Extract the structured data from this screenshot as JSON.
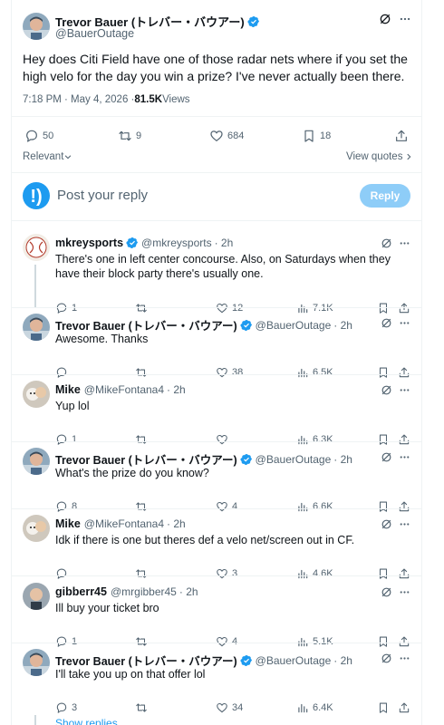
{
  "main_tweet": {
    "author_name": "Trevor Bauer (トレバー・バウアー)",
    "author_handle": "@BauerOutage",
    "text": "Hey does Citi Field have one of those radar nets where if you set the high velo for the day you win a prize? I've never actually been there.",
    "time": "7:18 PM · May 4, 2026 · ",
    "views_count": "81.5K",
    "views_label": " Views",
    "replies": "50",
    "reposts": "9",
    "likes": "684",
    "bookmarks": "18"
  },
  "sort": {
    "label": "Relevant",
    "view_quotes": "View quotes"
  },
  "reply_box": {
    "placeholder": "Post your reply",
    "button": "Reply"
  },
  "replies": [
    {
      "name": "mkreysports",
      "handle": "@mkreysports",
      "time": "· 2h",
      "verified": true,
      "text": "There's one in left center concourse.  Also, on Saturdays when they have their block party there's usually one.",
      "reply_count": "1",
      "repost_count": "",
      "like_count": "12",
      "view_count": "7.1K"
    },
    {
      "name": "Trevor Bauer (トレバー・バウアー)",
      "handle": "@BauerOutage",
      "time": "· 2h",
      "verified": true,
      "text": "Awesome. Thanks",
      "reply_count": "",
      "repost_count": "",
      "like_count": "38",
      "view_count": "6.5K"
    },
    {
      "name": "Mike",
      "handle": "@MikeFontana4",
      "time": "· 2h",
      "verified": false,
      "text": "Yup lol",
      "reply_count": "1",
      "repost_count": "",
      "like_count": "",
      "view_count": "6.3K"
    },
    {
      "name": "Trevor Bauer (トレバー・バウアー)",
      "handle": "@BauerOutage",
      "time": "· 2h",
      "verified": true,
      "text": "What's the prize do you know?",
      "reply_count": "8",
      "repost_count": "",
      "like_count": "4",
      "view_count": "6.6K"
    },
    {
      "name": "Mike",
      "handle": "@MikeFontana4",
      "time": "· 2h",
      "verified": false,
      "text": "Idk if there is one but theres def a velo net/screen out in CF.",
      "reply_count": "",
      "repost_count": "",
      "like_count": "3",
      "view_count": "4.6K"
    },
    {
      "name": "gibberr45",
      "handle": "@mrgibber45",
      "time": "· 2h",
      "verified": false,
      "text": "Ill buy your ticket bro",
      "reply_count": "1",
      "repost_count": "",
      "like_count": "4",
      "view_count": "5.1K"
    },
    {
      "name": "Trevor Bauer (トレバー・バウアー)",
      "handle": "@BauerOutage",
      "time": "· 2h",
      "verified": true,
      "text": "I'll take you up on that offer lol",
      "reply_count": "3",
      "repost_count": "",
      "like_count": "34",
      "view_count": "6.4K"
    }
  ],
  "show_replies": "Show replies",
  "colors": {
    "accent": "#1d9bf0",
    "muted": "#536471",
    "border": "#eff3f4"
  }
}
